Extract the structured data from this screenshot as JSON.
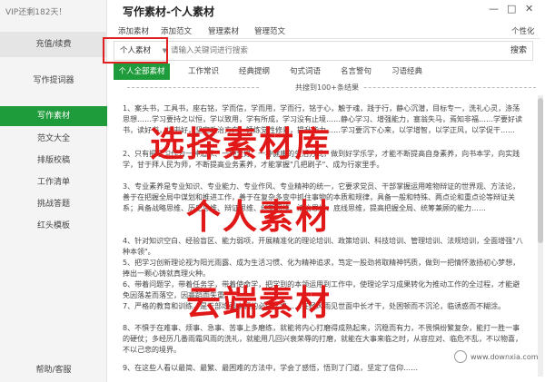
{
  "sidebar": {
    "vip_text": "VIP还剩182天！",
    "recharge": "充值/续费",
    "items": [
      {
        "label": "写作提词器",
        "active": false
      },
      {
        "label": "写作素材",
        "active": true
      },
      {
        "label": "范文大全",
        "active": false
      },
      {
        "label": "排版校稿",
        "active": false
      },
      {
        "label": "工作清单",
        "active": false
      },
      {
        "label": "挑战答题",
        "active": false
      },
      {
        "label": "红头模板",
        "active": false
      }
    ],
    "help": "帮助/客服"
  },
  "window": {
    "title": "写作素材-个人素材",
    "controls": [
      "—",
      "□",
      "✕"
    ]
  },
  "menu": {
    "items": [
      "添加素材",
      "添加范文",
      "管理素材",
      "管理范文"
    ],
    "personalize": "个性化"
  },
  "search": {
    "dropdown_value": "个人素材",
    "placeholder": "请输入关键词进行搜索",
    "button": "搜索"
  },
  "tabs": [
    "个人全部素材",
    "工作常识",
    "经典提纲",
    "句式词语",
    "名言警句",
    "习语经典"
  ],
  "count_text": "共搜到100+条结果",
  "paragraphs": [
    "1、案头书，工具书，座右铭，学而信，学而用，学而行，铭于心，触于魂，践于行，静心沉潜，目标专一，洗礼心灵，涤荡思想……学习要持之以恒，学以致用，学有所成，学习没有止境……静心学习、增强能力，塞翁失马，焉知非福……学要好读书，读好书，读书好，坚定政治方向，锤炼党性修养，提升能力……学习要沉下心来，以学增智，以学正风，以学促干……",
    "2、只有把学习作为一种追求、一种爱好、一种健康的生活方式，做到好学乐学，才能不断提高自身素养，向书本学，向实践学，甘于拜人民为师，不断提高业务素养，才能掌握\"几把刷子\"、成为行家里手。",
    "3、专业素养是专业知识、专业能力、专业作风、专业精神的统一，它要求党员、干部掌握运用唯物辩证的世界观、方法论，善于在把握全局中谋划和推进工作，善于在复杂多变中抓住事物的本质和规律，具备一般和特殊、两点论和重点论等辩证关系；具备战略思维、历史思维、辩证思维、创新思维、法治思维、底线思维，提高把握全局、统筹兼顾的能力……",
    "4、针对知识空白、经验盲区、能力弱项，开展精准化的理论培训、政策培训、科技培训、管理培训、法规培训，全面增强\"八种本领\"。",
    "5、把学习创新理论视为阳光雨露、成为生活习惯、化为精神追求，笃定一股劲将取精神钙质，做到一把情怀激扬初心梦想，捧出一颗心铸就真理火种。",
    "6、带着问题学，带着任务学，带着使命学，把学到的本领运用到工作中，使理论学习成果转化为推动工作的全过程，才能避免因落差而落空，因高蹈而失重。",
    "7、严格的教育和训练，是干部增强本领的必由之路……在经风雨见世面中长才干，处困顿而不沉沦，临诱惑而不糊涂。",
    "8、不惧于在难事、烦事、急事、苦事上多磨练，就能将内心打磨得成熟起来，沉稳而有力，不畏惧纷繁复杂，能打一胜一事的硬仗；多经历几番雨霜风雨的洗礼，就能用几回兴衰荣辱的打磨，就能在大事来临之时，从容应对、临危不乱，不以物喜，不以己悲的境界。",
    "9、在这些人看以最简、最繁、最困难的方法中，学会了感悟，悟到了门道，坚定了信仰……"
  ],
  "overlays": {
    "line1": "选择素材库",
    "line2": "个人素材",
    "line3": "云端素材"
  },
  "watermark": "www.downxia.com",
  "colors": {
    "accent_green": "#1e9b3a",
    "overlay_red": "#e01818"
  }
}
